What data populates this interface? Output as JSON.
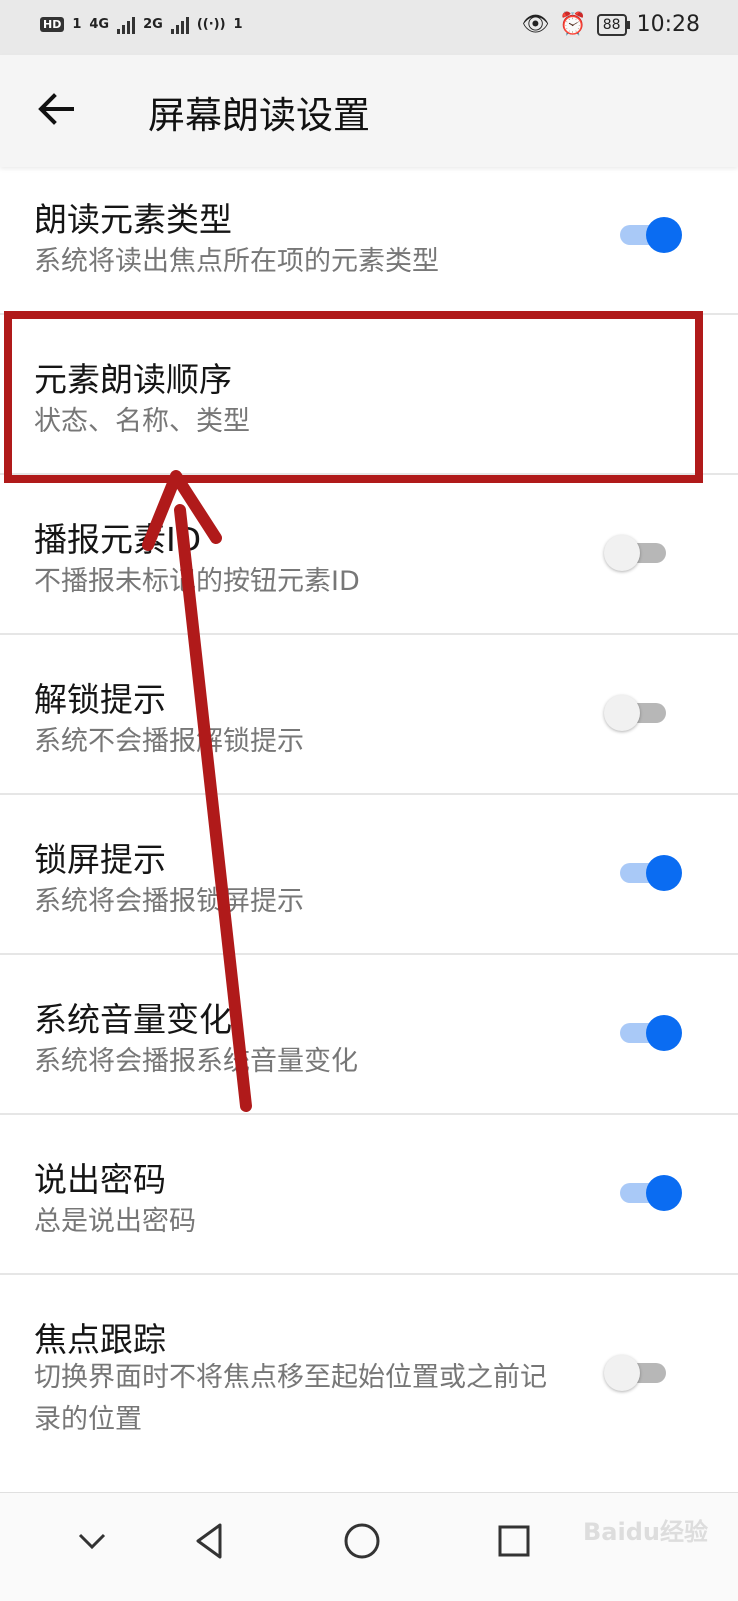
{
  "status_bar": {
    "hd": "HD",
    "sim1": "1",
    "net1": "4G",
    "net2": "2G",
    "hotspot": "1",
    "battery": "88",
    "time": "10:28"
  },
  "header": {
    "title": "屏幕朗读设置"
  },
  "items": [
    {
      "title": "朗读元素类型",
      "subtitle": "系统将读出焦点所在项的元素类型",
      "toggle": "on"
    },
    {
      "title": "元素朗读顺序",
      "subtitle": "状态、名称、类型"
    },
    {
      "title": "播报元素ID",
      "subtitle": "不播报未标记的按钮元素ID",
      "toggle": "off"
    },
    {
      "title": "解锁提示",
      "subtitle": "系统不会播报解锁提示",
      "toggle": "off"
    },
    {
      "title": "锁屏提示",
      "subtitle": "系统将会播报锁屏提示",
      "toggle": "on"
    },
    {
      "title": "系统音量变化",
      "subtitle": "系统将会播报系统音量变化",
      "toggle": "on"
    },
    {
      "title": "说出密码",
      "subtitle": "总是说出密码",
      "toggle": "on"
    },
    {
      "title": "焦点跟踪",
      "subtitle": "切换界面时不将焦点移至起始位置或之前记录的位置",
      "toggle": "off"
    }
  ],
  "watermark": "Baidu经验",
  "colors": {
    "accent": "#0a6cf2",
    "annotation": "#b01a1a"
  }
}
